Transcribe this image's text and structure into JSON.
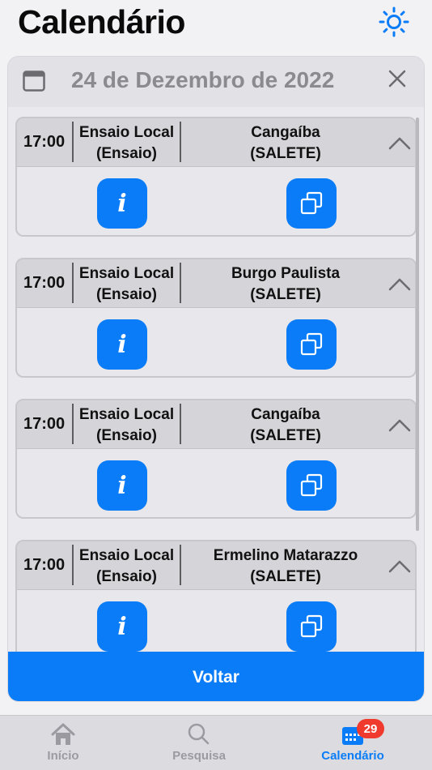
{
  "header": {
    "title": "Calendário",
    "theme_icon": "sun-icon"
  },
  "modal": {
    "date": "24 de Dezembro de 2022",
    "events": [
      {
        "time": "17:00",
        "type_line1": "Ensaio Local",
        "type_line2": "(Ensaio)",
        "place_line1": "Cangaíba",
        "place_line2": "(SALETE)"
      },
      {
        "time": "17:00",
        "type_line1": "Ensaio Local",
        "type_line2": "(Ensaio)",
        "place_line1": "Burgo Paulista",
        "place_line2": "(SALETE)"
      },
      {
        "time": "17:00",
        "type_line1": "Ensaio Local",
        "type_line2": "(Ensaio)",
        "place_line1": "Cangaíba",
        "place_line2": "(SALETE)"
      },
      {
        "time": "17:00",
        "type_line1": "Ensaio Local",
        "type_line2": "(Ensaio)",
        "place_line1": "Ermelino Matarazzo",
        "place_line2": "(SALETE)"
      }
    ],
    "info_glyph": "i",
    "back_label": "Voltar"
  },
  "tabbar": {
    "items": [
      {
        "label": "Início",
        "icon": "home-icon"
      },
      {
        "label": "Pesquisa",
        "icon": "search-icon"
      },
      {
        "label": "Calendário",
        "icon": "calendar-icon",
        "badge": "29"
      }
    ]
  },
  "colors": {
    "accent": "#0a7cf7",
    "badge": "#f03a2e",
    "inactive": "#9a9aa0"
  }
}
